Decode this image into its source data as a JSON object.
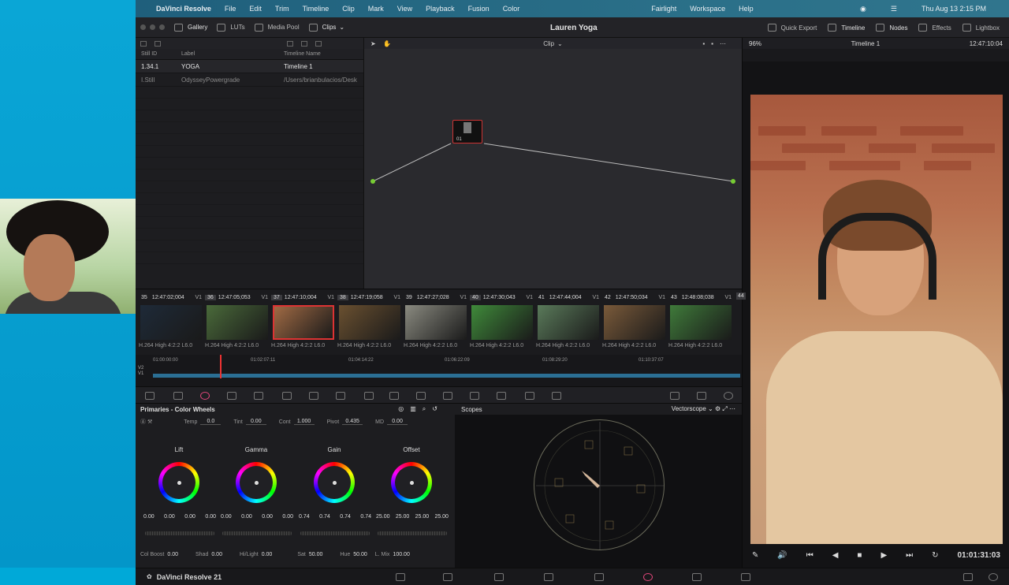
{
  "os_menu": {
    "apple": "",
    "app": "DaVinci Resolve",
    "items": [
      "File",
      "Edit",
      "Trim",
      "Timeline",
      "Clip",
      "Mark",
      "View",
      "Playback",
      "Fusion",
      "Color",
      "Fairlight",
      "Workspace",
      "Help"
    ],
    "clock": "Thu Aug 13  2:15 PM"
  },
  "toolbar": {
    "gallery": "Gallery",
    "luts": "LUTs",
    "media_pool": "Media Pool",
    "clips": "Clips",
    "project_title": "Lauren Yoga",
    "quick_export": "Quick Export",
    "timeline": "Timeline",
    "nodes": "Nodes",
    "effects": "Effects",
    "lightbox": "Lightbox"
  },
  "gallery": {
    "headers": {
      "still_id": "Still ID",
      "label": "Label",
      "timeline_name": "Timeline Name"
    },
    "rows": [
      {
        "id": "1.34.1",
        "label": "YOGA",
        "timeline": "Timeline 1"
      },
      {
        "id": "I.Still",
        "label": "OdysseyPowergrade",
        "timeline": "/Users/brianbulacios/Desk"
      }
    ]
  },
  "nodes": {
    "mode": "Clip",
    "node_label": "01"
  },
  "viewer": {
    "zoom": "96%",
    "timeline": "Timeline 1",
    "timecode_top": "12:47:10:04",
    "timecode_bottom": "01:01:31:03"
  },
  "clips": [
    {
      "num": "35",
      "tc": "12:47:02;004",
      "track": "V1",
      "codec": "H.264 High 4:2:2 L6.0",
      "hl": false,
      "color": "#1e2a38"
    },
    {
      "num": "36",
      "tc": "12:47:05;053",
      "track": "V1",
      "codec": "H.264 High 4:2:2 L6.0",
      "hl": true,
      "color": "#4a6a3a"
    },
    {
      "num": "37",
      "tc": "12:47:10;004",
      "track": "V1",
      "codec": "H.264 High 4:2:2 L6.0",
      "hl": true,
      "color": "#a06a44"
    },
    {
      "num": "38",
      "tc": "12:47:19;058",
      "track": "V1",
      "codec": "H.264 High 4:2:2 L6.0",
      "hl": true,
      "color": "#6a5030"
    },
    {
      "num": "39",
      "tc": "12:47:27;028",
      "track": "V1",
      "codec": "H.264 High 4:2:2 L6.0",
      "hl": false,
      "color": "#8a8a80"
    },
    {
      "num": "40",
      "tc": "12:47:30;043",
      "track": "V1",
      "codec": "H.264 High 4:2:2 L6.0",
      "hl": true,
      "color": "#3f8a3a"
    },
    {
      "num": "41",
      "tc": "12:47:44;004",
      "track": "V1",
      "codec": "H.264 High 4:2:2 L6.0",
      "hl": false,
      "color": "#5a7a5a"
    },
    {
      "num": "42",
      "tc": "12:47:50;034",
      "track": "V1",
      "codec": "H.264 High 4:2:2 L6.0",
      "hl": false,
      "color": "#7a5a3a"
    },
    {
      "num": "43",
      "tc": "12:48:08;038",
      "track": "V1",
      "codec": "H.264 High 4:2:2 L6.0",
      "hl": false,
      "color": "#3f7a3a"
    }
  ],
  "clip_overflow": "44",
  "ruler": {
    "tracks": [
      "V2",
      "V1"
    ],
    "marks": [
      "01:00:00:00",
      "01:02:07:11",
      "01:04:14:22",
      "01:06:22:09",
      "01:08:29:20",
      "01:10:37:07"
    ]
  },
  "primaries": {
    "title": "Primaries - Color Wheels",
    "temp_label": "Temp",
    "temp": "0.0",
    "tint_label": "Tint",
    "tint": "0.00",
    "cont_label": "Cont",
    "cont": "1.000",
    "pivot_label": "Pivot",
    "pivot": "0.435",
    "md_label": "MD",
    "md": "0.00",
    "wheels": [
      {
        "name": "Lift",
        "vals": [
          "0.00",
          "0.00",
          "0.00",
          "0.00"
        ]
      },
      {
        "name": "Gamma",
        "vals": [
          "0.00",
          "0.00",
          "0.00",
          "0.00"
        ]
      },
      {
        "name": "Gain",
        "vals": [
          "0.74",
          "0.74",
          "0.74",
          "0.74"
        ]
      },
      {
        "name": "Offset",
        "vals": [
          "25.00",
          "25.00",
          "25.00",
          "25.00"
        ]
      }
    ],
    "colboost_label": "Col Boost",
    "colboost": "0.00",
    "shad_label": "Shad",
    "shad": "0.00",
    "hilight_label": "Hi/Light",
    "hilight": "0.00",
    "sat_label": "Sat",
    "sat": "50.00",
    "hue_label": "Hue",
    "hue": "50.00",
    "lmix_label": "L. Mix",
    "lmix": "100.00"
  },
  "scopes": {
    "title": "Scopes",
    "mode": "Vectorscope"
  },
  "status": {
    "brand": "DaVinci Resolve 21"
  },
  "colors": {
    "accent": "#e0467a",
    "selected": "#dd3333",
    "track": "#2b6f94"
  }
}
